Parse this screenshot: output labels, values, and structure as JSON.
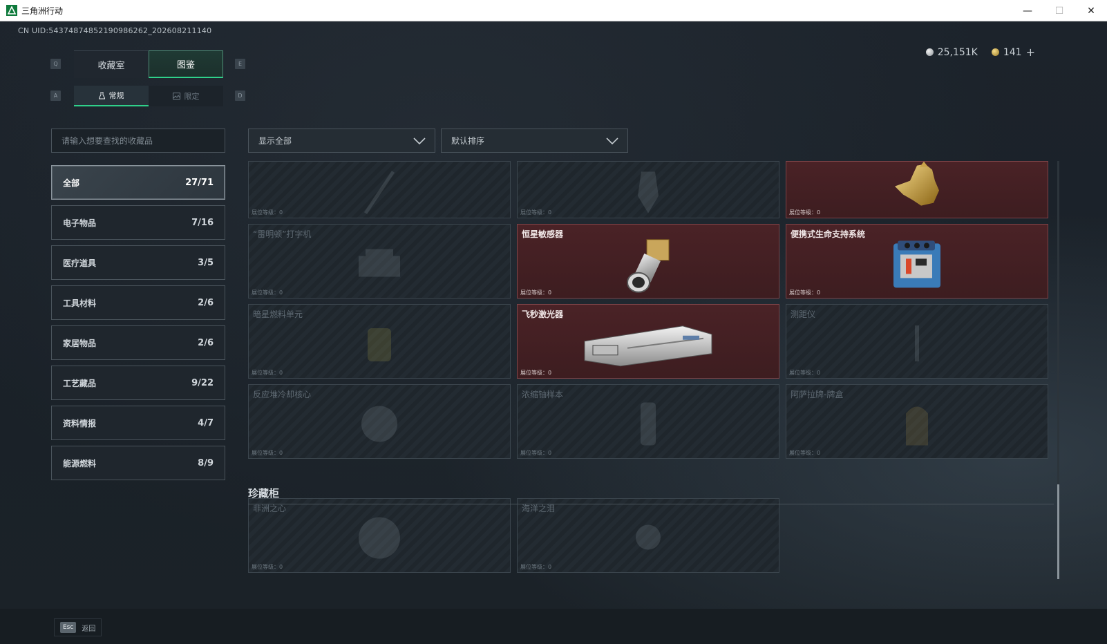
{
  "window": {
    "title": "三角洲行动"
  },
  "header": {
    "uid": "CN UID:5437487485219098626​2_202608211140",
    "currency": [
      {
        "icon": "silver-coin-icon",
        "value": "25,151K"
      },
      {
        "icon": "gold-coin-icon",
        "value": "141"
      }
    ],
    "add_label": "+"
  },
  "tabs": {
    "main": [
      {
        "label": "收藏室"
      },
      {
        "label": "图鉴"
      }
    ],
    "sub": [
      {
        "label": "常规"
      },
      {
        "label": "限定"
      }
    ],
    "keys": {
      "prev_main": "Q",
      "next_main": "E",
      "prev_sub": "A",
      "next_sub": "D"
    }
  },
  "search": {
    "placeholder": "请输入想要查找的收藏品"
  },
  "filters": {
    "show": "显示全部",
    "sort": "默认排序"
  },
  "categories": [
    {
      "label": "全部",
      "count": "27/71"
    },
    {
      "label": "电子物品",
      "count": "7/16"
    },
    {
      "label": "医疗道具",
      "count": "3/5"
    },
    {
      "label": "工具材料",
      "count": "2/6"
    },
    {
      "label": "家居物品",
      "count": "2/6"
    },
    {
      "label": "工艺藏品",
      "count": "9/22"
    },
    {
      "label": "资料情报",
      "count": "4/7"
    },
    {
      "label": "能源燃料",
      "count": "8/9"
    }
  ],
  "level_label": "展位等级：0",
  "items": [
    {
      "name": ""
    },
    {
      "name": ""
    },
    {
      "name": ""
    },
    {
      "name": "“雷明顿”打字机"
    },
    {
      "name": "恒星敏感器"
    },
    {
      "name": "便携式生命支持系统"
    },
    {
      "name": "暗星燃料单元"
    },
    {
      "name": "飞秒激光器"
    },
    {
      "name": "测距仪"
    },
    {
      "name": "反应堆冷却核心"
    },
    {
      "name": "浓缩铀样本"
    },
    {
      "name": "阿萨拉牌-牌盒"
    }
  ],
  "showcase": {
    "title": "珍藏柜",
    "items": [
      {
        "name": "非洲之心"
      },
      {
        "name": "海洋之泪"
      }
    ]
  },
  "footer": {
    "esc_key": "Esc",
    "esc_label": "返回"
  },
  "colors": {
    "accent": "#2fd08a",
    "owned_card": "#4a2226",
    "background": "#1b222a"
  }
}
